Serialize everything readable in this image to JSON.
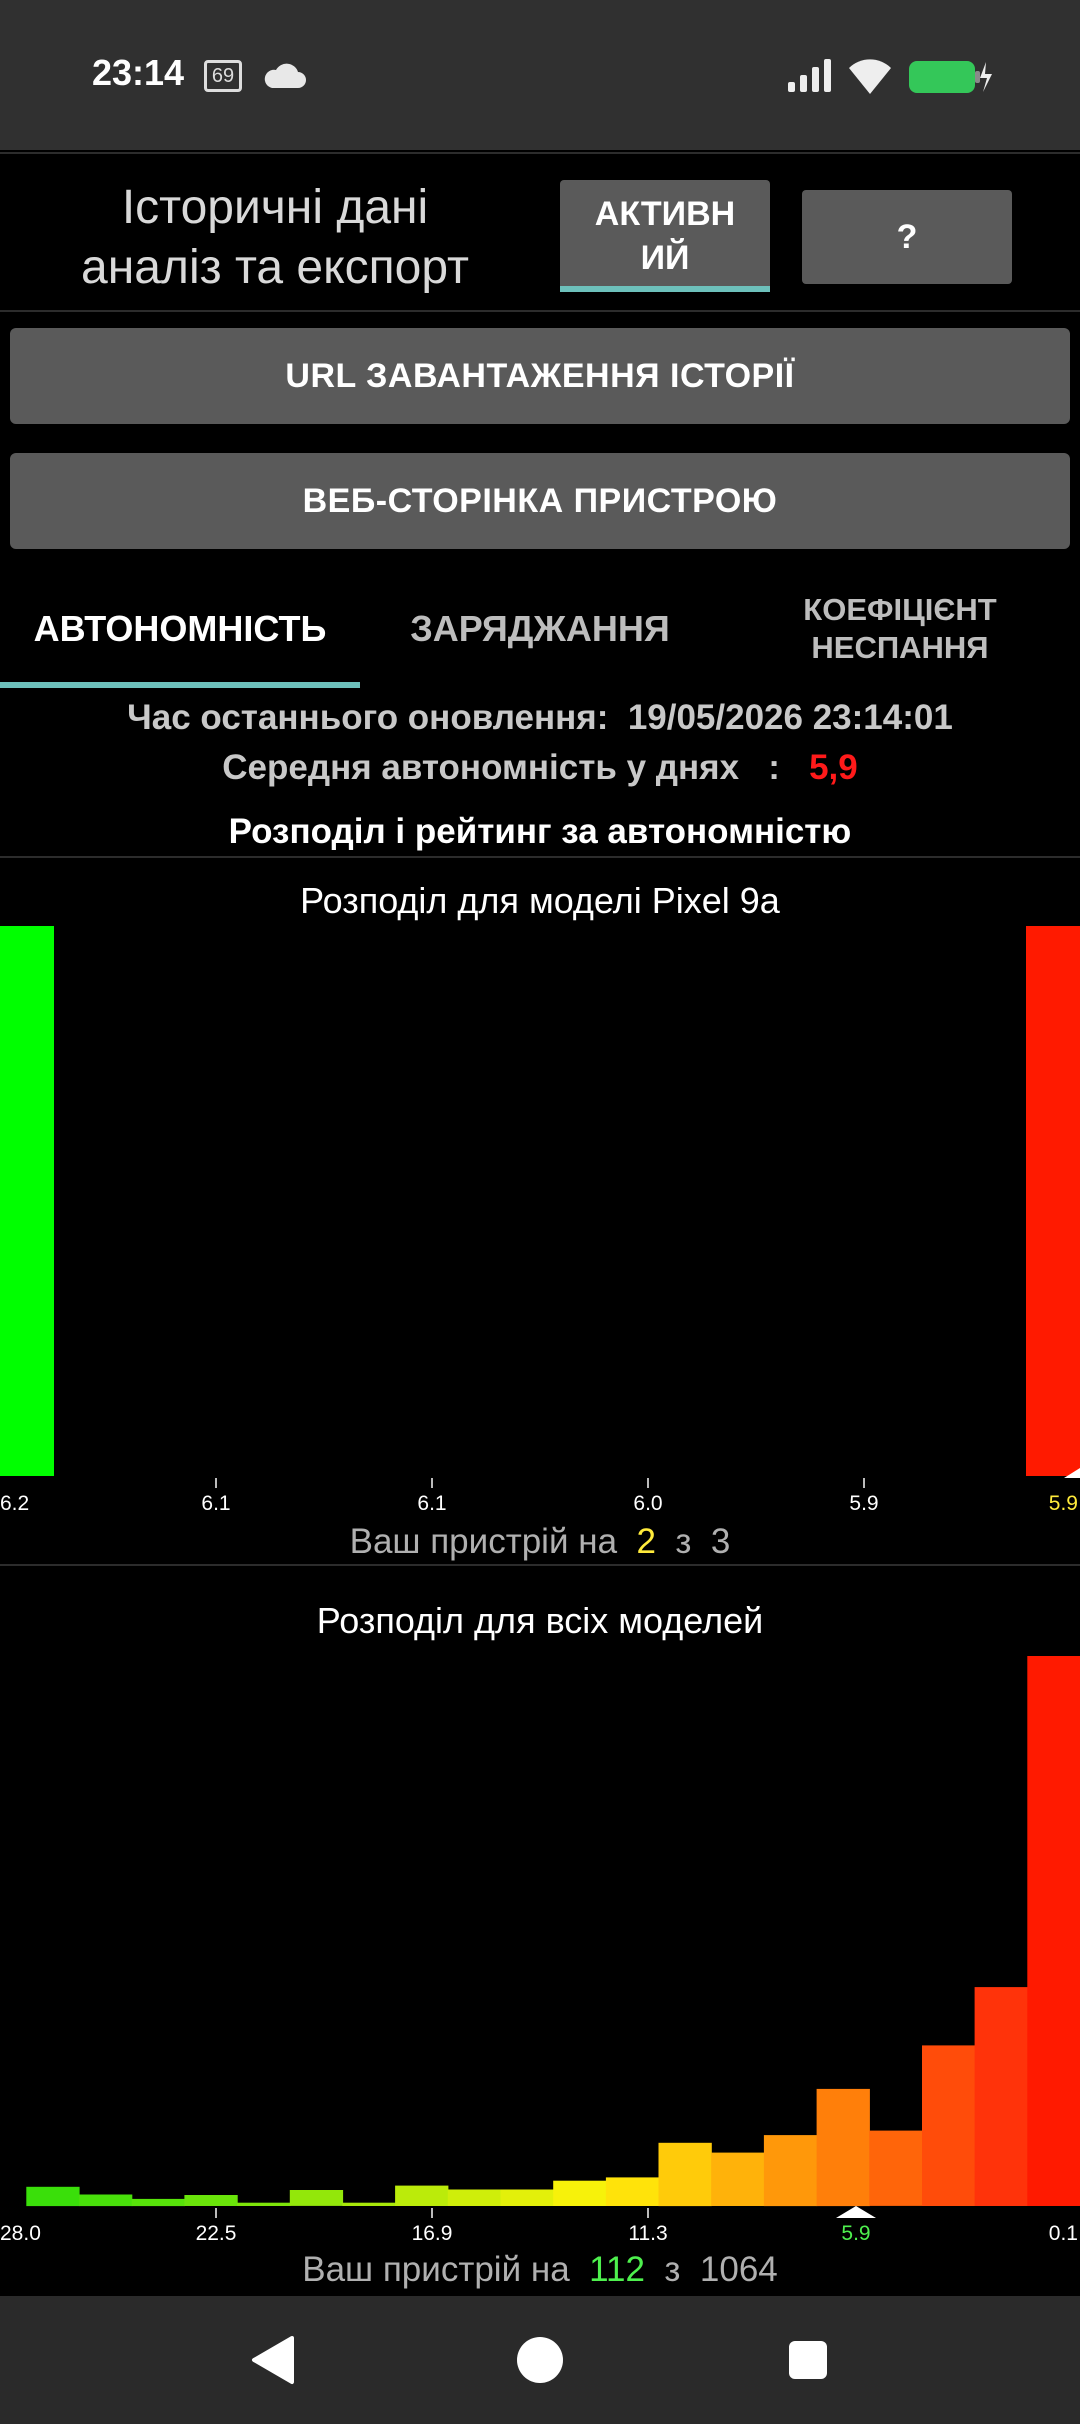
{
  "status_bar": {
    "time": "23:14",
    "temperature_badge": "69",
    "icons": [
      "temperature-badge-icon",
      "cloud-icon",
      "cellular-signal-icon",
      "wifi-icon",
      "battery-charging-icon"
    ],
    "battery_color": "#34c759"
  },
  "header": {
    "title_line1": "Історичні дані",
    "title_line2": "аналіз та експорт",
    "active_button_line1": "АКТИВН",
    "active_button_line2": "ИЙ",
    "help_button": "?"
  },
  "buttons": {
    "history_url": "URL ЗАВАНТАЖЕННЯ ІСТОРІЇ",
    "device_page": "ВЕБ-СТОРІНКА ПРИСТРОЮ"
  },
  "tabs": {
    "autonomy": "АВТОНОМНІСТЬ",
    "charging": "ЗАРЯДЖАННЯ",
    "wakelock_line1": "КОЕФІЦІЄНТ",
    "wakelock_line2": "НЕСПАННЯ",
    "selected": "autonomy",
    "indicator_color": "#6dc0bb"
  },
  "info": {
    "last_update_label": "Час останнього оновлення:",
    "last_update_value": "19/05/2026 23:14:01",
    "avg_label": "Середня автономність у днях",
    "avg_sep": ":",
    "avg_value": "5,9",
    "section_heading": "Розподіл і рейтинг за автономністю"
  },
  "chart_data": [
    {
      "type": "bar",
      "title": "Розподіл для моделі Pixel 9a",
      "x_tick_labels": [
        "6.2",
        "6.1",
        "6.1",
        "6.0",
        "5.9",
        "5.9"
      ],
      "bars": [
        {
          "position": "6.2",
          "value": 1,
          "color": "#00ff00"
        },
        {
          "position": "5.9",
          "value": 1,
          "color": "#ff1a00"
        }
      ],
      "marker": {
        "label": "5.9",
        "color": "#ffeb3b"
      },
      "rank_prefix": "Ваш пристрій на",
      "rank": "2",
      "rank_sep": "з",
      "total": "3"
    },
    {
      "type": "bar",
      "title": "Розподіл для всіх моделей",
      "x_tick_labels": [
        "28.0",
        "22.5",
        "16.9",
        "11.3",
        "5.9",
        "0.1"
      ],
      "values": [
        3.5,
        2.1,
        1.3,
        2.0,
        0.6,
        2.9,
        0.6,
        3.7,
        3.0,
        3.0,
        4.6,
        5.2,
        11.5,
        9.7,
        12.9,
        21.3,
        13.7,
        29.2,
        39.8,
        100
      ],
      "colors": [
        "#3adf0a",
        "#48e00a",
        "#57e20a",
        "#6ae40a",
        "#7ee50a",
        "#93e70a",
        "#a8e80a",
        "#bbeb0a",
        "#cfee0a",
        "#e3f00a",
        "#f7f20a",
        "#ffe30a",
        "#ffcb0a",
        "#ffb20a",
        "#ff980a",
        "#ff7f0a",
        "#ff650a",
        "#ff4c0a",
        "#ff330a",
        "#ff1a00"
      ],
      "marker": {
        "label": "5.9",
        "color": "#4ef04e"
      },
      "rank_prefix": "Ваш пристрій на",
      "rank": "112",
      "rank_sep": "з",
      "total": "1064"
    }
  ],
  "nav_bar": {
    "icons": [
      "back-icon",
      "home-icon",
      "recents-icon"
    ]
  }
}
